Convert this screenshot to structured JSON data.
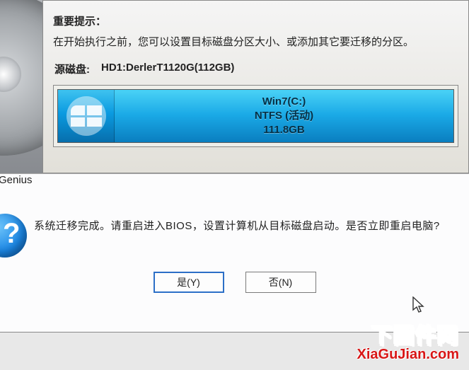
{
  "tip": {
    "title": "重要提示：",
    "text": "在开始执行之前，您可以设置目标磁盘分区大小、或添加其它要迁移的分区。"
  },
  "source_disk": {
    "label": "源磁盘:",
    "value": "HD1:DerlerT1120G(112GB)"
  },
  "partition": {
    "name": "Win7(C:)",
    "fs": "NTFS (活动)",
    "size": "111.8GB"
  },
  "dialog": {
    "title": "Genius",
    "message": "系统迁移完成。请重启进入BIOS，设置计算机从目标磁盘启动。是否立即重启电脑?",
    "yes": "是(Y)",
    "no": "否(N)"
  },
  "watermark": {
    "line1": "下固件网",
    "line2": "XiaGuJian.com"
  }
}
